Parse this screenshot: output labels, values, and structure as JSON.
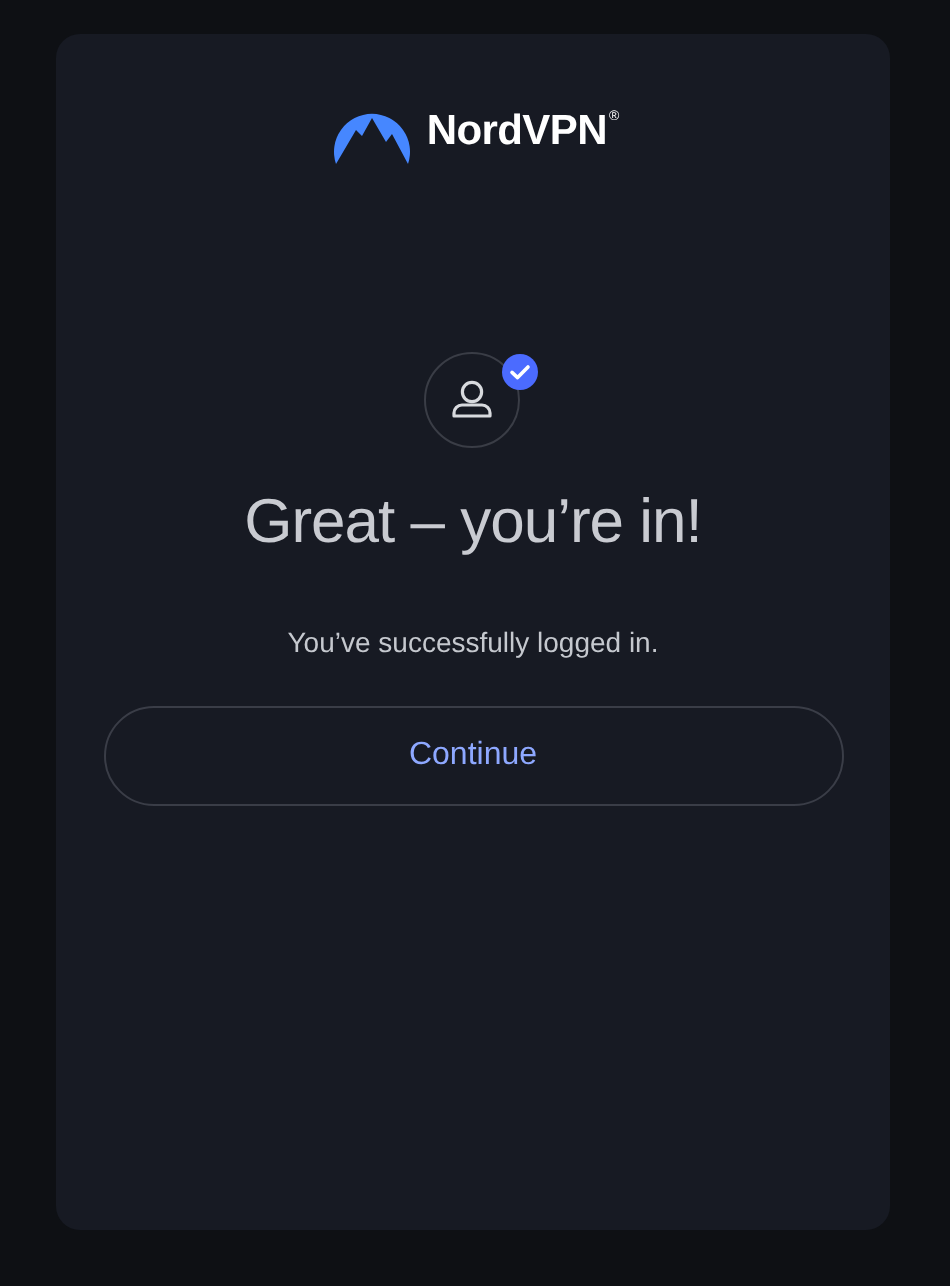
{
  "brand": {
    "name": "NordVPN",
    "mark": "®"
  },
  "heading": "Great – you’re in!",
  "message": "You’ve successfully logged in.",
  "button": {
    "label": "Continue"
  }
}
